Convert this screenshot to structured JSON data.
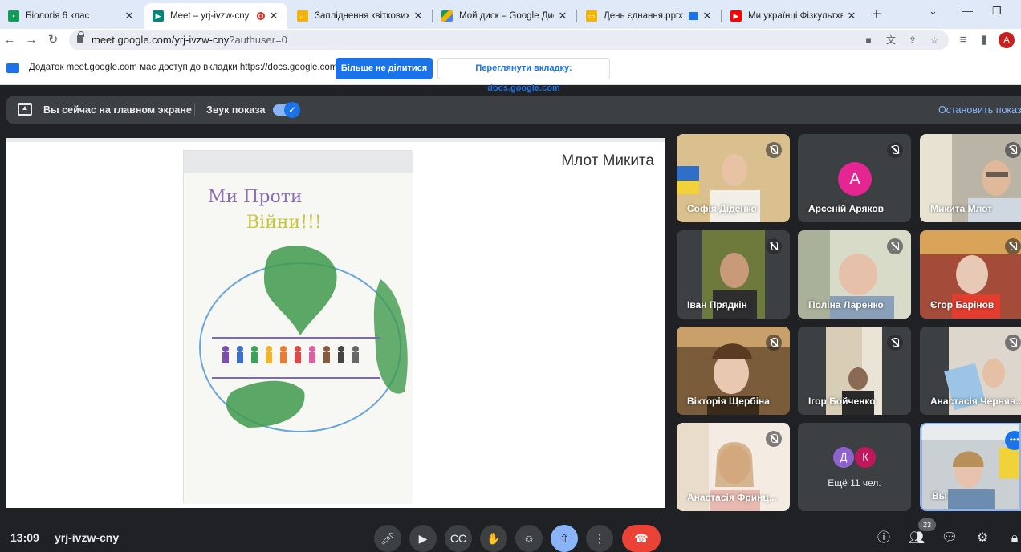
{
  "browser": {
    "tabs": [
      {
        "title": "Біологія 6 клас"
      },
      {
        "title": "Meet – yrj-ivzw-cny"
      },
      {
        "title": "Запліднення квіткових рос"
      },
      {
        "title": "Мой диск – Google Диск"
      },
      {
        "title": "День єднання.pptx - G"
      },
      {
        "title": "Ми українці Фізкультхвил"
      }
    ],
    "url": "meet.google.com/yrj-ivzw-cny",
    "url_query": "?authuser=0",
    "profile_initial": "A"
  },
  "infobar": {
    "message": "Додаток meet.google.com має доступ до вкладки https://docs.google.com",
    "stop_sharing_label": "Більше не ділитися",
    "switch_tab_label": "Переглянути вкладку: docs.google.com"
  },
  "presenting_bar": {
    "status": "Вы сейчас на главном экране",
    "audio_label": "Звук показа",
    "audio_enabled": true,
    "stop_label": "Остановить показ"
  },
  "stage": {
    "presenter_name": "Млот Микита",
    "drawing_text_line1": "Ми Проти",
    "drawing_text_line2": "Війни!!!"
  },
  "participants": [
    {
      "name": "Софія Діденко",
      "muted": true
    },
    {
      "name": "Арсеній Аряков",
      "muted": true,
      "initial": "А",
      "color": "#e52592"
    },
    {
      "name": "Микита Млот",
      "muted": true
    },
    {
      "name": "Іван Прядкін",
      "muted": true
    },
    {
      "name": "Поліна Ларенко",
      "muted": true
    },
    {
      "name": "Єгор Барінов",
      "muted": true
    },
    {
      "name": "Вікторія Щербіна",
      "muted": true
    },
    {
      "name": "Ігор Бойченко",
      "muted": true
    },
    {
      "name": "Анастасія Черняв...",
      "muted": true
    },
    {
      "name": "Анастасія Фринц...",
      "muted": true
    }
  ],
  "more_tile": {
    "initials": [
      "Д",
      "К"
    ],
    "colors": [
      "#8e63ce",
      "#c2185b"
    ],
    "label": "Ещё 11 чел."
  },
  "self_tile": {
    "name": "Вы"
  },
  "bottom": {
    "time": "13:09",
    "meeting_code": "yrj-ivzw-cny",
    "participant_count": "23"
  }
}
